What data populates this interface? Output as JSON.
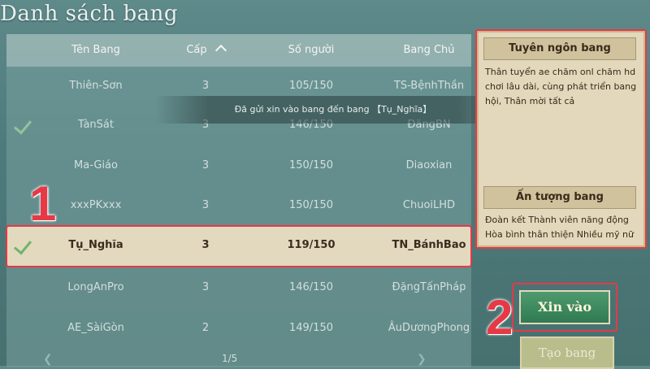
{
  "window": {
    "title": "Danh sách bang"
  },
  "table": {
    "headers": {
      "name": "Tên Bang",
      "level": "Cấp",
      "members": "Số người",
      "leader": "Bang Chủ"
    },
    "rows": [
      {
        "name": "Thiên-Sơn",
        "level": "3",
        "members": "105/150",
        "leader": "TS-BệnhThần",
        "checked": false
      },
      {
        "name": "TànSát",
        "level": "3",
        "members": "146/150",
        "leader": "ĐăngBN",
        "checked": true
      },
      {
        "name": "Ma-Giáo",
        "level": "3",
        "members": "150/150",
        "leader": "Diaoxian",
        "checked": false
      },
      {
        "name": "xxxPKxxx",
        "level": "3",
        "members": "150/150",
        "leader": "ChuoiLHD",
        "checked": false
      },
      {
        "name": "Tụ_Nghĩa",
        "level": "3",
        "members": "119/150",
        "leader": "TN_BánhBao",
        "checked": true
      },
      {
        "name": "LongAnPro",
        "level": "3",
        "members": "146/150",
        "leader": "ĐặngTấnPháp",
        "checked": false
      },
      {
        "name": "AE_SàiGòn",
        "level": "2",
        "members": "149/150",
        "leader": "ÂuDươngPhong",
        "checked": false
      }
    ]
  },
  "toast": "Đã gửi xin vào bang đến bang 【Tụ_Nghĩa】",
  "pager": {
    "page": "1/5"
  },
  "info": {
    "declaration_title": "Tuyên ngôn bang",
    "declaration_text": "Thân tuyển ae chăm onl chăm hd chơi lâu dài, cùng phát triển bang hội, Thân mời tất cả",
    "impression_title": "Ấn tượng bang",
    "impression_text": "Đoàn kết Thành viên năng động Hòa bình thân thiện Nhiều mỹ nữ"
  },
  "buttons": {
    "join": "Xin vào",
    "create": "Tạo bang"
  },
  "annotations": {
    "step1": "1",
    "step2": "2"
  },
  "colors": {
    "highlight": "#e63946",
    "join_button": "#2f7a52",
    "selected_row": "#e2d9bf"
  }
}
